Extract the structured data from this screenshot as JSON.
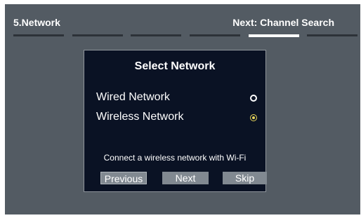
{
  "header": {
    "step_title": "5.Network",
    "next_step": "Next: Channel Search"
  },
  "progress": {
    "total_steps": 6,
    "current_step": 5
  },
  "dialog": {
    "title": "Select Network",
    "options": [
      {
        "label": "Wired Network",
        "selected": false
      },
      {
        "label": "Wireless Network",
        "selected": true
      }
    ],
    "description": "Connect a wireless network with Wi-Fi",
    "buttons": {
      "previous": "Previous",
      "next": "Next",
      "skip": "Skip"
    }
  },
  "colors": {
    "screen_background": "#535b63",
    "dialog_background": "#0a1224",
    "button_background": "#818991",
    "radio_selected": "#e8d55a"
  }
}
